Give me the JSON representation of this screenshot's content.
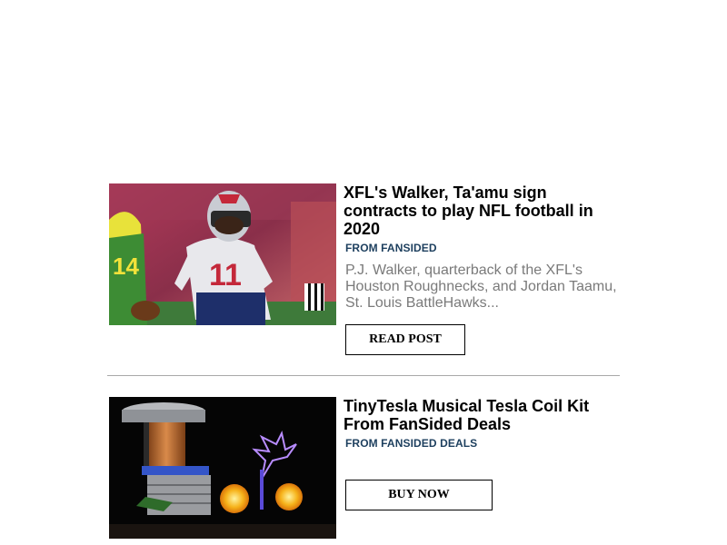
{
  "articles": [
    {
      "title": "XFL's Walker, Ta'amu sign contracts to play NFL football in 2020",
      "source": "FROM FANSIDED",
      "excerpt": "P.J. Walker, quarterback of the XFL's Houston Roughnecks, and Jordan Taamu, St. Louis BattleHawks...",
      "cta_label": "READ POST",
      "image_icon": "football-player-photo"
    },
    {
      "title": "TinyTesla Musical Tesla Coil Kit From FanSided Deals",
      "source": "FROM FANSIDED DEALS",
      "cta_label": "BUY NOW",
      "image_icon": "tesla-coil-photo"
    }
  ],
  "colors": {
    "title": "#000000",
    "source": "#1d3f5e",
    "excerpt": "#7a7a7a",
    "divider": "#a8a8a8"
  }
}
